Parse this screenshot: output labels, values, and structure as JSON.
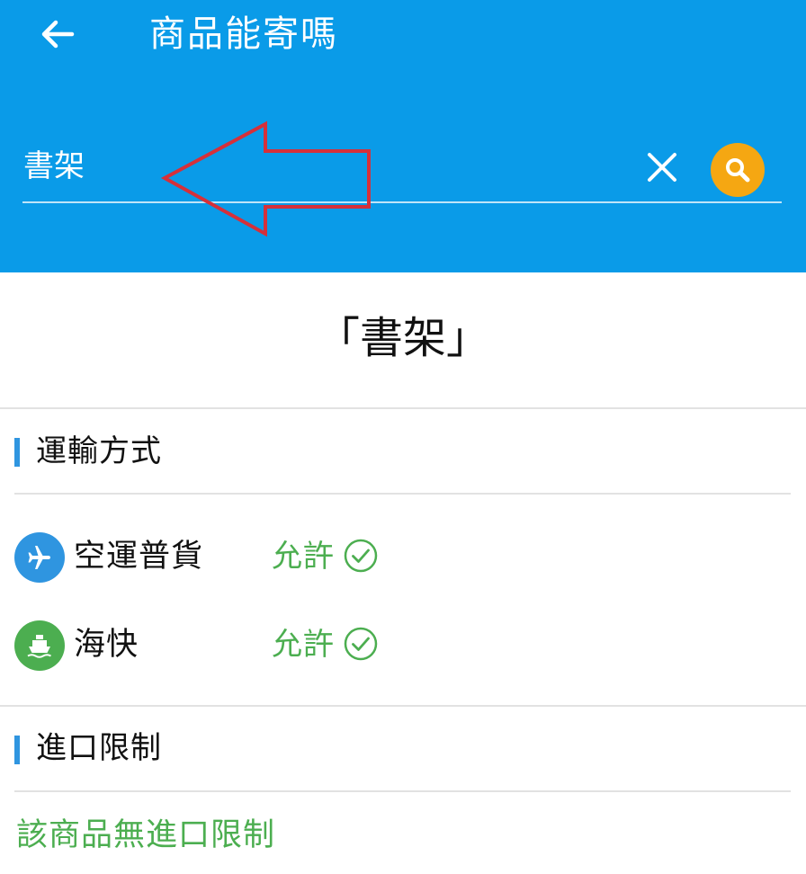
{
  "header": {
    "title": "商品能寄嗎",
    "background": "#0a9be8",
    "back_icon": "arrow-left-icon"
  },
  "search": {
    "value": "書架",
    "clear_icon": "close-icon",
    "search_icon": "search-icon",
    "search_button_color": "#f5a712"
  },
  "annotation": {
    "icon": "red-arrow-icon",
    "color": "#d6303a"
  },
  "result": {
    "title": "「書架」"
  },
  "shipping_section": {
    "title": "運輸方式",
    "accent": "#2f95e0",
    "methods": [
      {
        "name": "空運普貨",
        "status": "允許",
        "icon": "airplane-icon",
        "icon_color": "#2f95e0",
        "status_icon": "check-circle-icon"
      },
      {
        "name": "海快",
        "status": "允許",
        "icon": "ship-icon",
        "icon_color": "#4cae50",
        "status_icon": "check-circle-icon"
      }
    ]
  },
  "import_section": {
    "title": "進口限制",
    "message": "該商品無進口限制",
    "message_color": "#4cae50"
  }
}
